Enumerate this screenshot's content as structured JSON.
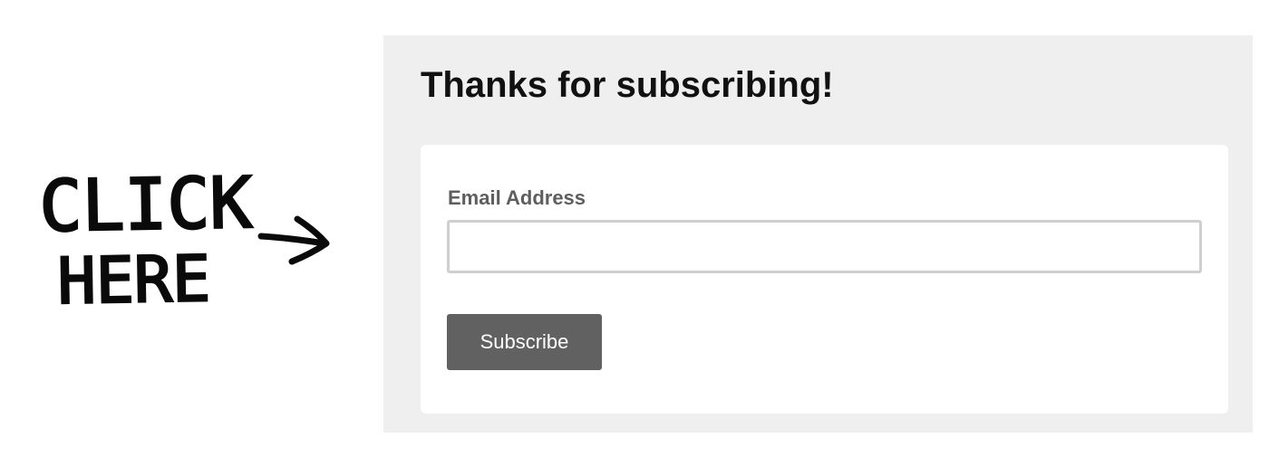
{
  "annotation": {
    "line1": "CLICK",
    "line2": "HERE",
    "arrow_icon": "hand-drawn-right-arrow-icon"
  },
  "form": {
    "title": "Thanks for subscribing!",
    "email_label": "Email Address",
    "email_value": "",
    "email_placeholder": "",
    "submit_label": "Subscribe"
  },
  "colors": {
    "panel_bg": "#efefef",
    "card_bg": "#ffffff",
    "button_bg": "#616161",
    "label_text": "#5e5e5e",
    "input_border": "#cfcfcf"
  }
}
